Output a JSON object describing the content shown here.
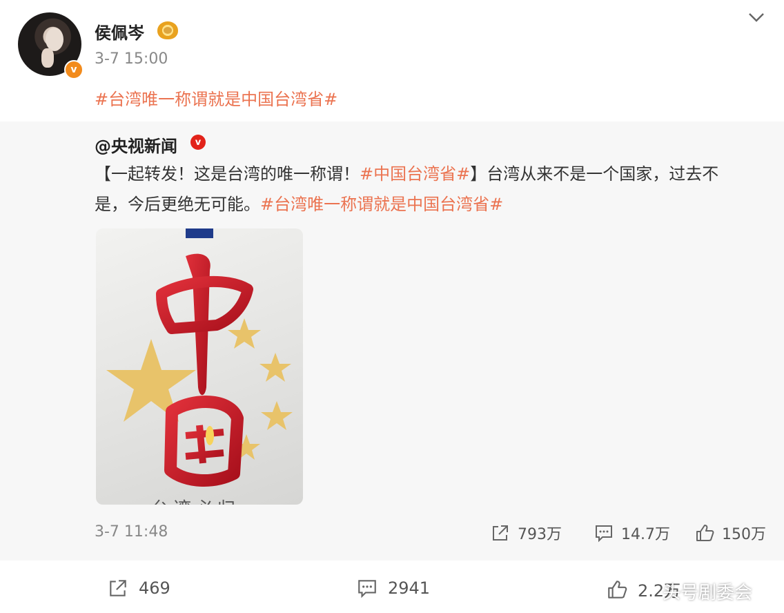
{
  "post": {
    "username": "侯佩岑",
    "time": "3-7 15:00",
    "topic": "#台湾唯一称谓就是中国台湾省#"
  },
  "repost": {
    "source": "@央视新闻",
    "text_part1": "【一起转发！这是台湾的唯一称谓！",
    "tag1": "#中国台湾省#",
    "text_part2": "】台湾从来不是一个国家，过去不是，今后更绝无可能。",
    "tag2": "#台湾唯一称谓就是中国台湾省#",
    "image_bottom_text": "台湾必归",
    "time": "3-7 11:48",
    "shares": "793万",
    "comments": "14.7万",
    "likes": "150万"
  },
  "footer": {
    "shares": "469",
    "comments": "2941",
    "likes": "2.2万",
    "watermark": "头号剧委会"
  },
  "icons": [
    "verified-badge-icon",
    "medal-icon",
    "chevron-down-icon",
    "share-icon",
    "comment-icon",
    "like-icon"
  ],
  "colors": {
    "topic": "#eb7350",
    "verified": "#f28b1c",
    "cctv_badge": "#e2231a"
  }
}
